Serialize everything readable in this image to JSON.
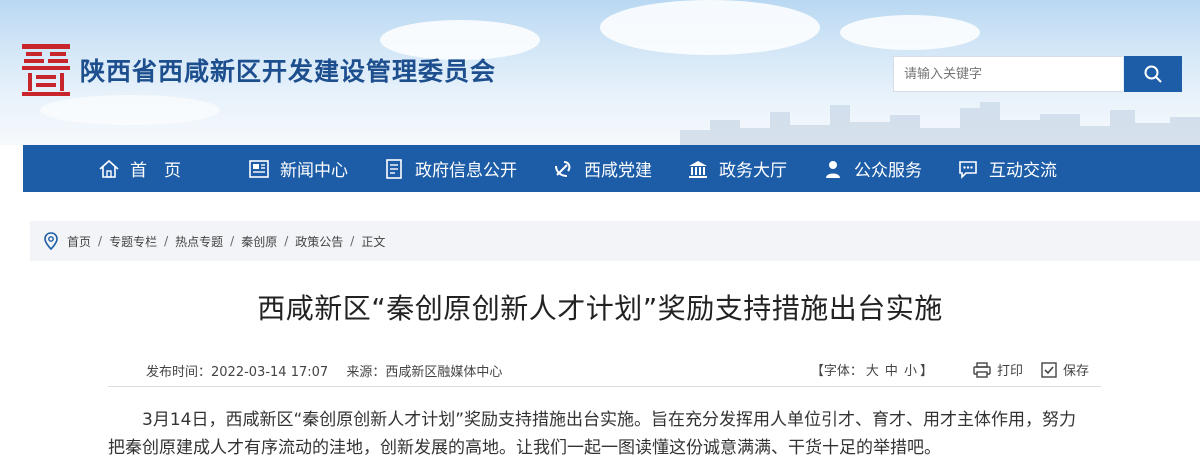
{
  "header": {
    "site_title": "陕西省西咸新区开发建设管理委员会",
    "search_placeholder": "请输入关键字"
  },
  "nav": {
    "items": [
      {
        "label": "首　页",
        "icon": "home-icon"
      },
      {
        "label": "新闻中心",
        "icon": "news-icon"
      },
      {
        "label": "政府信息公开",
        "icon": "document-icon"
      },
      {
        "label": "西咸党建",
        "icon": "party-emblem-icon"
      },
      {
        "label": "政务大厅",
        "icon": "building-icon"
      },
      {
        "label": "公众服务",
        "icon": "user-service-icon"
      },
      {
        "label": "互动交流",
        "icon": "chat-icon"
      }
    ]
  },
  "breadcrumb": {
    "items": [
      "首页",
      "专题专栏",
      "热点专题",
      "秦创原",
      "政策公告",
      "正文"
    ],
    "separator": "/"
  },
  "article": {
    "title": "西咸新区“秦创原创新人才计划”奖励支持措施出台实施",
    "publish_time_label": "发布时间：",
    "publish_time": "2022-03-14 17:07",
    "source_label": "来源：",
    "source": "西咸新区融媒体中心",
    "font_size_prefix": "【字体：",
    "font_sizes": [
      "大",
      "中",
      "小"
    ],
    "font_size_suffix": "】",
    "print_label": "打印",
    "save_label": "保存",
    "body": "3月14日，西咸新区“秦创原创新人才计划”奖励支持措施出台实施。旨在充分发挥用人单位引才、育才、用才主体作用，努力把秦创原建成人才有序流动的洼地，创新发展的高地。让我们一起一图读懂这份诚意满满、干货十足的举措吧。"
  },
  "colors": {
    "brand_blue": "#1d5da8",
    "logo_red": "#c8242b",
    "title_blue": "#1d4f8e"
  }
}
